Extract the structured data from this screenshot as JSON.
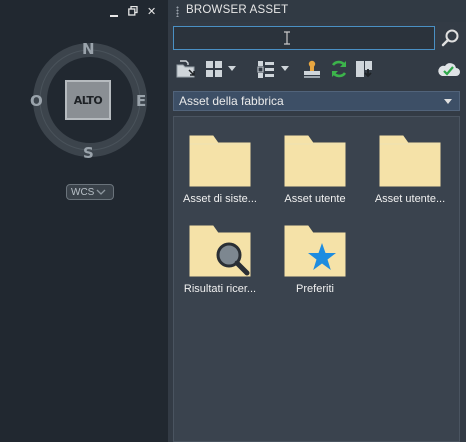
{
  "viewport": {
    "compass": {
      "north": "N",
      "south": "S",
      "east": "E",
      "west": "O"
    },
    "cube_face": "ALTO",
    "ucs_label": "WCS"
  },
  "palette": {
    "title": "BROWSER ASSET",
    "search": {
      "value": "",
      "placeholder": ""
    },
    "toolbar_icons": [
      "import-folder-icon",
      "view-grid-icon",
      "sort-list-icon",
      "stamp-icon",
      "refresh-icon",
      "save-to-library-icon",
      "cloud-sync-icon"
    ],
    "library": {
      "selected": "Asset della fabbrica"
    },
    "items": [
      {
        "label": "Asset di siste...",
        "icon": "folder-icon"
      },
      {
        "label": "Asset utente",
        "icon": "folder-icon"
      },
      {
        "label": "Asset utente...",
        "icon": "folder-icon"
      },
      {
        "label": "Risultati ricer...",
        "icon": "search-folder-icon"
      },
      {
        "label": "Preferiti",
        "icon": "favorites-folder-icon"
      }
    ]
  },
  "colors": {
    "accent": "#4a90c4",
    "folder": "#f5e2a8",
    "star": "#1d8ce0",
    "refresh": "#3cb44b"
  }
}
